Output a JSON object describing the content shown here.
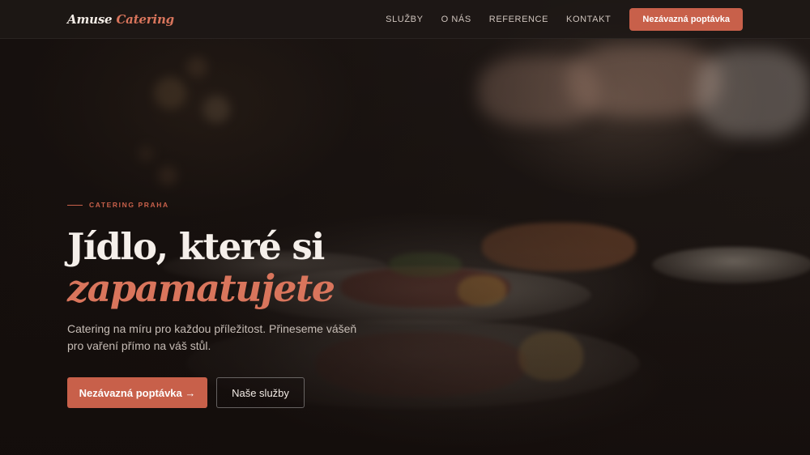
{
  "nav": {
    "logo_main": "Amuse",
    "logo_accent": "Catering",
    "links": [
      "SLUŽBY",
      "O NÁS",
      "REFERENCE",
      "KONTAKT"
    ],
    "cta_label": "Nezávazná poptávka"
  },
  "hero": {
    "eyebrow": "CATERING PRAHA",
    "headline_line1": "Jídlo, které si",
    "headline_line2": "zapamatujete",
    "subtitle": "Catering na míru pro každou příležitost. Přineseme vášeň pro vaření přímo na váš stůl.",
    "primary_button": "Nezávazná poptávka →",
    "secondary_button": "Naše služby"
  },
  "colors": {
    "accent": "#c8604a",
    "accent_text": "#d9755c",
    "background": "#1a1412",
    "heading": "#f5efea"
  }
}
